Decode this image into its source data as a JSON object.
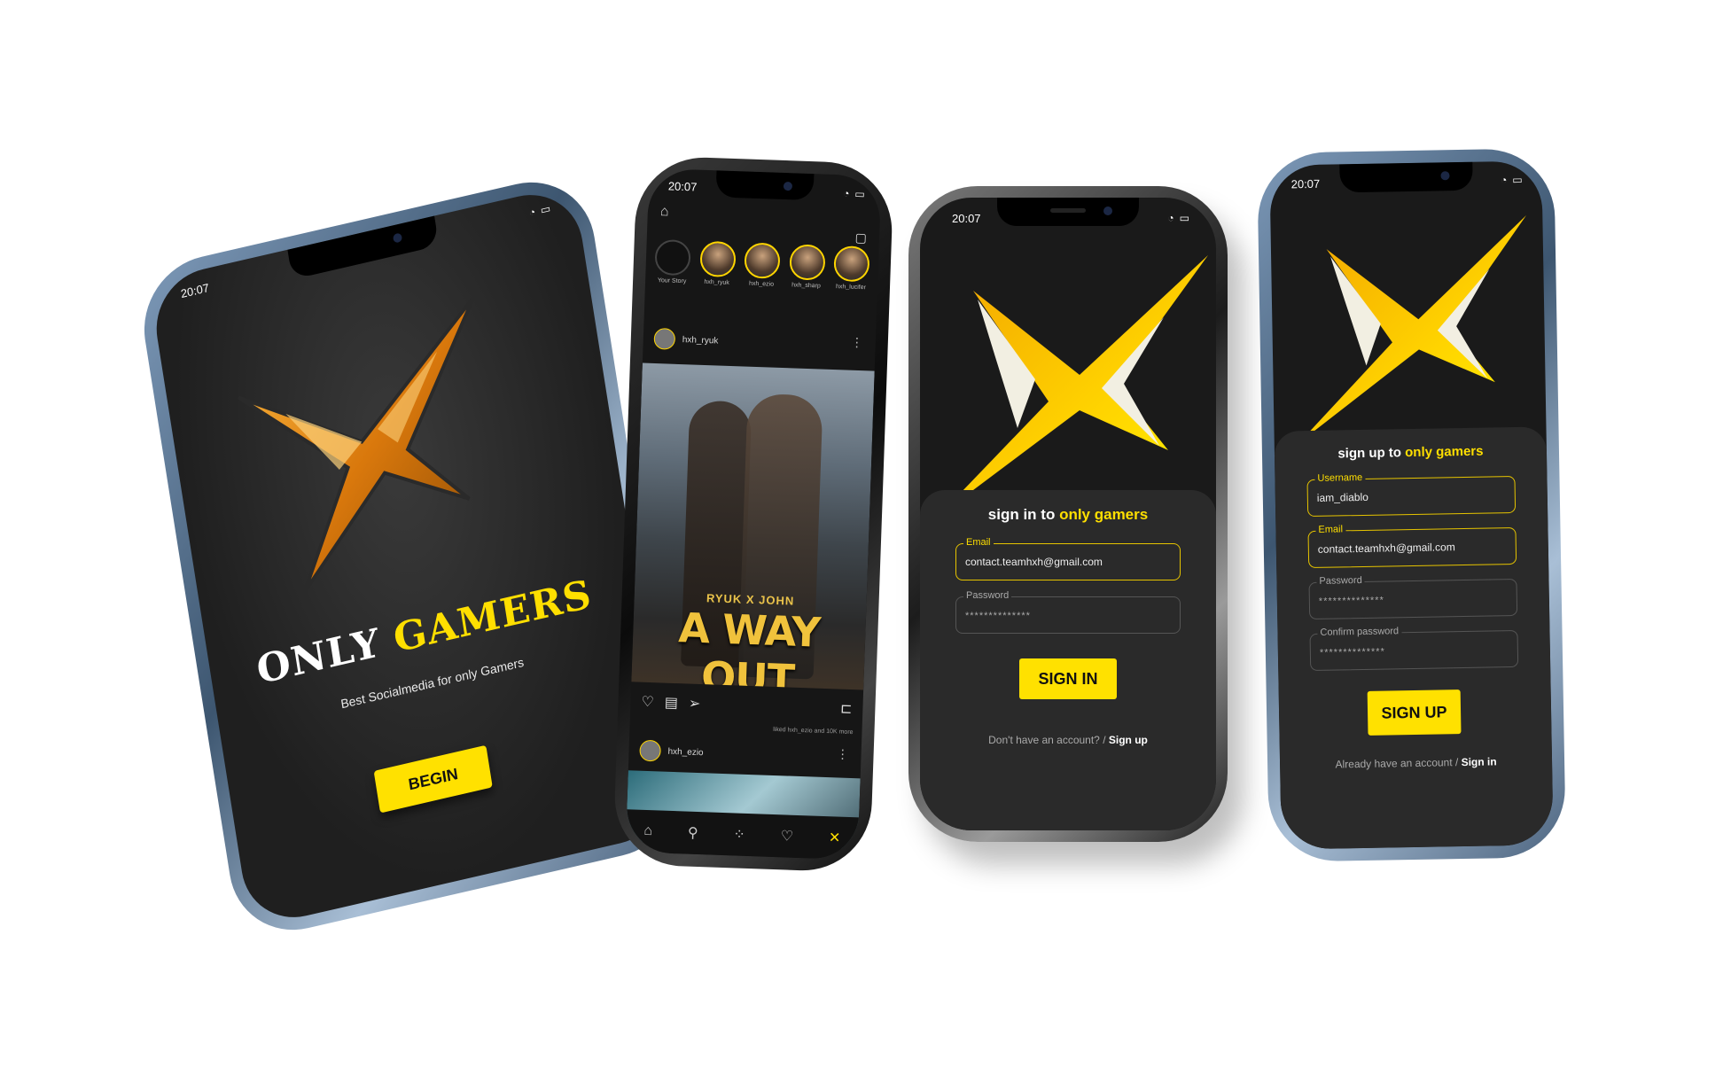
{
  "welcome": {
    "time": "20:07",
    "brand_only": "ONLY",
    "brand_gamers": "GAMERS",
    "tagline": "Best Socialmedia for only Gamers",
    "begin_label": "BEGIN"
  },
  "feed": {
    "time": "20:07",
    "stories": [
      {
        "label": "Your Story"
      },
      {
        "label": "hxh_ryuk"
      },
      {
        "label": "hxh_ezio"
      },
      {
        "label": "hxh_sharp"
      },
      {
        "label": "hxh_lucifer"
      }
    ],
    "post1": {
      "username": "hxh_ryuk",
      "image_title_small": "RYUK X JOHN",
      "image_title_big": "A WAY OUT",
      "liked_text": "liked hxh_ezio and 10K more"
    },
    "post2": {
      "username": "hxh_ezio"
    }
  },
  "signin": {
    "time": "20:07",
    "title_prefix": "sign in to ",
    "title_highlight": "only gamers",
    "email_label": "Email",
    "email_value": "contact.teamhxh@gmail.com",
    "password_label": "Password",
    "password_mask": "**************",
    "button": "SIGN IN",
    "switch_text": "Don't have an account? / ",
    "switch_link": "Sign up"
  },
  "signup": {
    "time": "20:07",
    "title_prefix": "sign up to ",
    "title_highlight": "only gamers",
    "username_label": "Username",
    "username_value": "iam_diablo",
    "email_label": "Email",
    "email_value": "contact.teamhxh@gmail.com",
    "password_label": "Password",
    "password_mask": "**************",
    "confirm_label": "Confirm password",
    "confirm_mask": "**************",
    "button": "SIGN UP",
    "switch_text": "Already have an account / ",
    "switch_link": "Sign in"
  },
  "colors": {
    "accent": "#ffe100",
    "background": "#1e1e1e",
    "logo_orange": "#e08a12"
  }
}
